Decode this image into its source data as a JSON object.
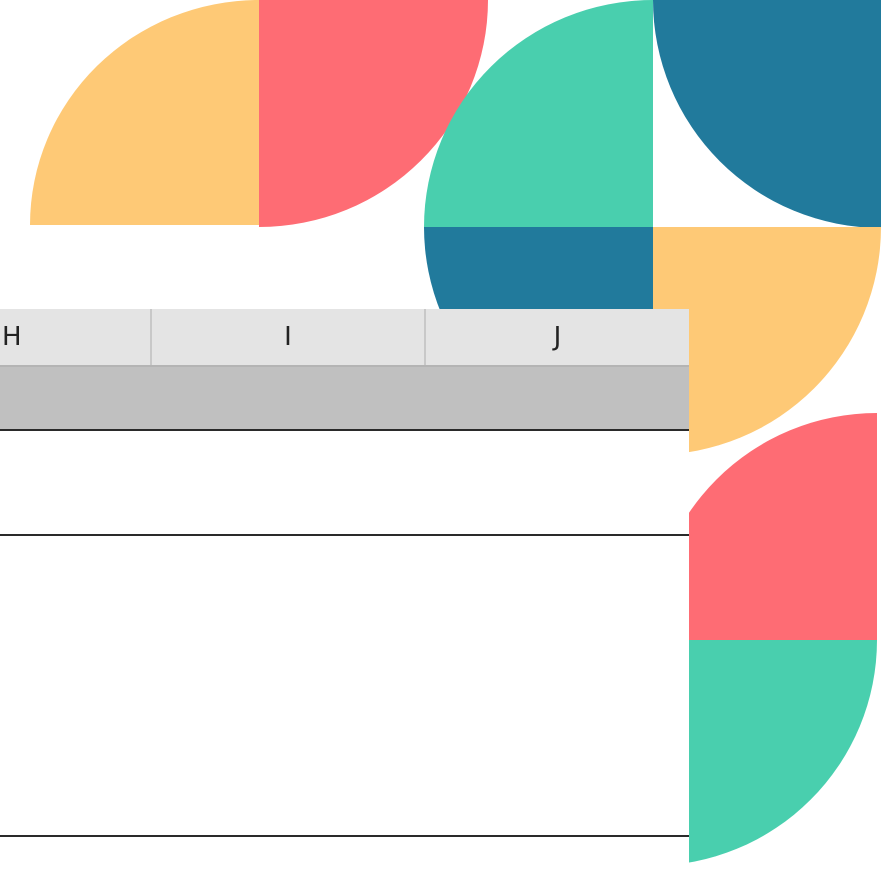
{
  "spreadsheet": {
    "columns": [
      {
        "label": "H"
      },
      {
        "label": "I"
      },
      {
        "label": "J"
      }
    ]
  },
  "colors": {
    "yellow": "#fec976",
    "coral": "#fe6c74",
    "mint": "#49cfae",
    "teal": "#217a9c",
    "header_bg": "#e4e4e4",
    "band_bg": "#c0c0c0"
  }
}
